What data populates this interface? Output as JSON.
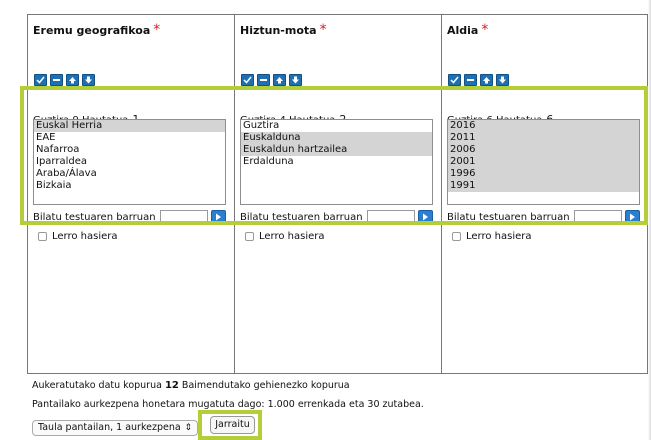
{
  "columns": [
    {
      "title": "Eremu geografikoa",
      "required_marker": "*",
      "summary": "Guztira 9 Hautatua",
      "selected_count": "1",
      "options": [
        {
          "label": "Euskal Herria",
          "selected": true
        },
        {
          "label": "EAE",
          "selected": false
        },
        {
          "label": "Nafarroa",
          "selected": false
        },
        {
          "label": "Iparraldea",
          "selected": false
        },
        {
          "label": "Araba/Álava",
          "selected": false
        },
        {
          "label": "Bizkaia",
          "selected": false
        }
      ],
      "search_label": "Bilatu testuaren barruan",
      "search_value": "",
      "checkbox_label": "Lerro hasiera"
    },
    {
      "title": "Hiztun-mota",
      "required_marker": "*",
      "summary": "Guztira 4 Hautatua",
      "selected_count": "2",
      "options": [
        {
          "label": "Guztira",
          "selected": false
        },
        {
          "label": "Euskalduna",
          "selected": true
        },
        {
          "label": "Euskaldun hartzailea",
          "selected": true
        },
        {
          "label": "Erdalduna",
          "selected": false
        }
      ],
      "search_label": "Bilatu testuaren barruan",
      "search_value": "",
      "checkbox_label": "Lerro hasiera"
    },
    {
      "title": "Aldia",
      "required_marker": "*",
      "summary": "Guztira 6 Hautatua",
      "selected_count": "6",
      "options": [
        {
          "label": "2016",
          "selected": true
        },
        {
          "label": "2011",
          "selected": true
        },
        {
          "label": "2006",
          "selected": true
        },
        {
          "label": "2001",
          "selected": true
        },
        {
          "label": "1996",
          "selected": true
        },
        {
          "label": "1991",
          "selected": true
        }
      ],
      "search_label": "Bilatu testuaren barruan",
      "search_value": "",
      "checkbox_label": "Lerro hasiera"
    }
  ],
  "icons": [
    "select-all-icon",
    "deselect-all-icon",
    "arrow-up-icon",
    "arrow-down-icon"
  ],
  "info": {
    "line1_prefix": "Aukeratutako datu kopurua",
    "line1_value": "12",
    "line1_suffix": "Baimendutako gehienezko kopurua",
    "line2": "Pantailako aurkezpena honetara mugatuta dago: 1.000 errenkada eta 30 zutabea."
  },
  "presentation_select": {
    "value": "Taula pantailan, 1 aurkezpena"
  },
  "continue_button": "Jarraitu",
  "colors": {
    "highlight": "#b3ce36",
    "icon_blue": "#1f6fb4",
    "required_red": "#d42020",
    "selected_bg": "#d4d4d4"
  }
}
